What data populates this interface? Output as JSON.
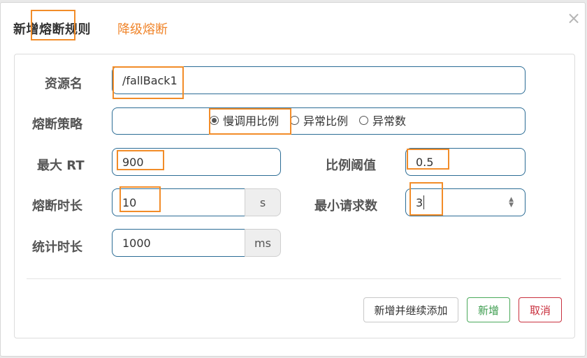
{
  "dialog": {
    "tabs": [
      "新增熔断规则",
      "降级熔断"
    ],
    "close_icon": "×"
  },
  "form": {
    "resource": {
      "label": "资源名",
      "value": "/fallBack1"
    },
    "strategy": {
      "label": "熔断策略",
      "options": [
        "慢调用比例",
        "异常比例",
        "异常数"
      ],
      "selected": "慢调用比例"
    },
    "max_rt": {
      "label": "最大 RT",
      "value": "900"
    },
    "ratio_threshold": {
      "label": "比例阈值",
      "value": "0.5"
    },
    "duration": {
      "label": "熔断时长",
      "value": "10",
      "unit": "s"
    },
    "min_requests": {
      "label": "最小请求数",
      "value": "3"
    },
    "stat_duration": {
      "label": "统计时长",
      "value": "1000",
      "unit": "ms"
    }
  },
  "footer": {
    "add_continue": "新增并继续添加",
    "add": "新增",
    "cancel": "取消"
  },
  "colors": {
    "highlight": "#f28c28",
    "tab_inactive": "#f0852b",
    "field_border": "#2b6c95",
    "success": "#3a9b4c",
    "danger": "#c9303e"
  }
}
